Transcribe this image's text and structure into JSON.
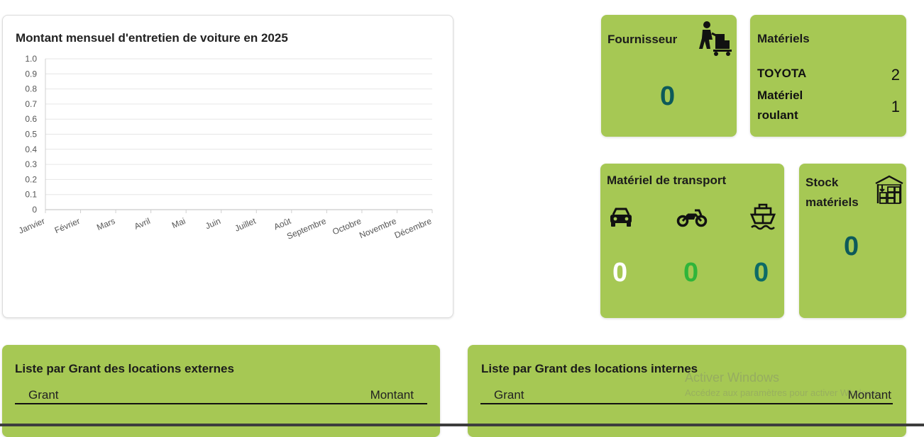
{
  "chart": {
    "title": "Montant mensuel d'entretien de voiture en 2025"
  },
  "chart_data": {
    "type": "line",
    "title": "Montant mensuel d'entretien de voiture en 2025",
    "categories": [
      "Janvier",
      "Février",
      "Mars",
      "Avril",
      "Mai",
      "Juin",
      "Juillet",
      "Août",
      "Septembre",
      "Octobre",
      "Novembre",
      "Décembre"
    ],
    "series": [],
    "ylim": [
      0,
      1.0
    ],
    "yticks": [
      "0",
      "0.1",
      "0.2",
      "0.3",
      "0.4",
      "0.5",
      "0.6",
      "0.7",
      "0.8",
      "0.9",
      "1.0"
    ],
    "grid": true
  },
  "fournisseur": {
    "title": "Fournisseur",
    "value": "0",
    "icon": "supplier-cart-icon"
  },
  "materiels": {
    "title": "Matériels",
    "rows": [
      {
        "name": "TOYOTA",
        "value": "2"
      },
      {
        "name_line1": "Matériel",
        "name_line2": "roulant",
        "value": "1"
      }
    ]
  },
  "transport": {
    "title": "Matériel de transport",
    "items": [
      {
        "icon": "car-icon",
        "value": "0",
        "color": "#ffffff"
      },
      {
        "icon": "motorcycle-icon",
        "value": "0",
        "color": "#2fb53a"
      },
      {
        "icon": "ship-icon",
        "value": "0",
        "color": "#0d6b66"
      }
    ]
  },
  "stock": {
    "title_line1": "Stock",
    "title_line2": "matériels",
    "value": "0",
    "icon": "warehouse-icon"
  },
  "locations_externes": {
    "title": "Liste par Grant des locations externes",
    "col1": "Grant",
    "col2": "Montant"
  },
  "locations_internes": {
    "title": "Liste par Grant des locations internes",
    "col1": "Grant",
    "col2": "Montant"
  },
  "watermark": {
    "title": "Activer Windows",
    "subtitle": "Accédez aux paramètres pour activer Windows."
  },
  "colors": {
    "card_green": "#a6c854",
    "value_teal": "#0d5a5a",
    "accent_green": "#2fb53a"
  }
}
